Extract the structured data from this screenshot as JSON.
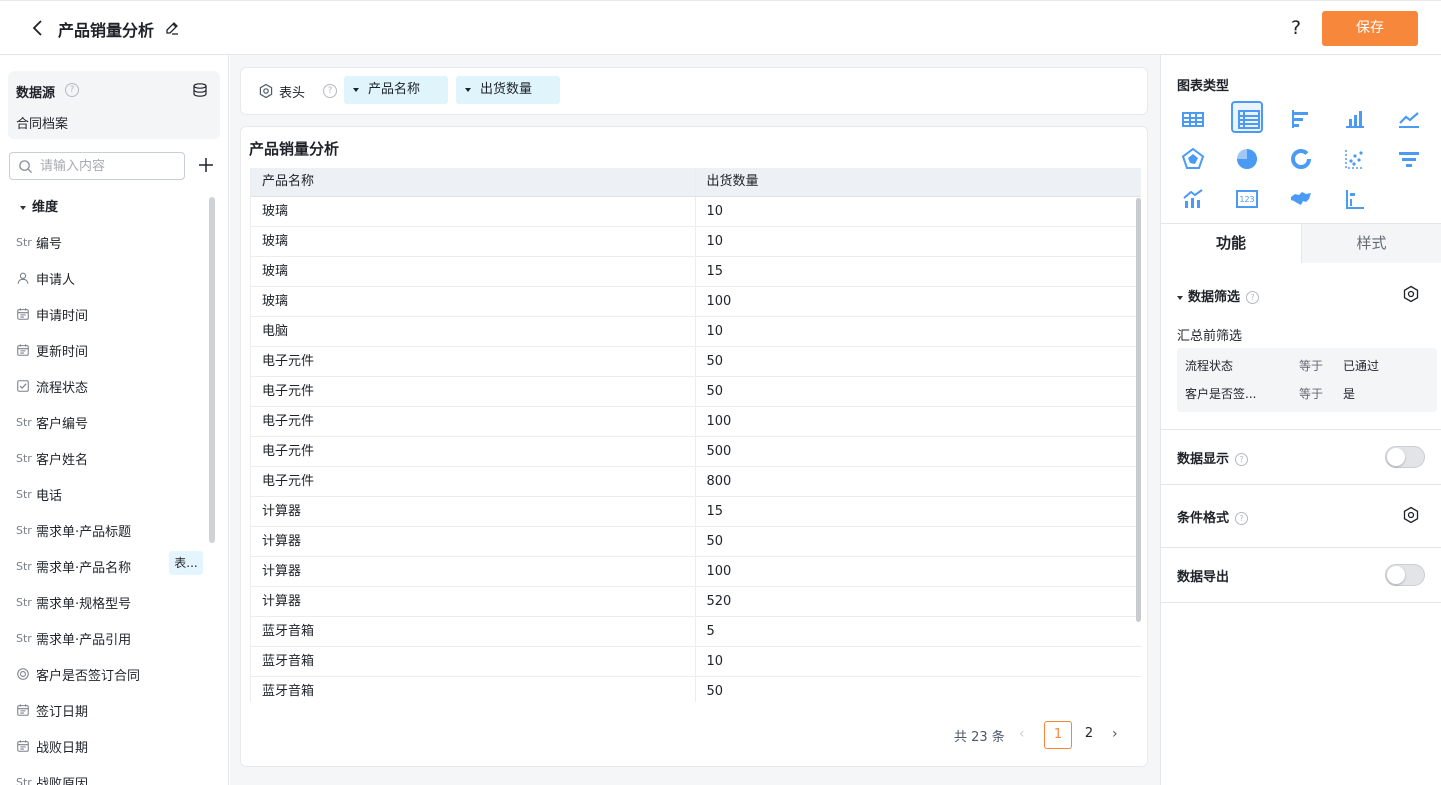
{
  "header": {
    "title": "产品销量分析",
    "help": "?",
    "save_label": "保存",
    "accent": "#f7873b"
  },
  "left": {
    "datasource_title": "数据源",
    "datasource_name": "合同档案",
    "search_placeholder": "请输入内容",
    "dimension_title": "维度",
    "fields": [
      {
        "icon": "Str",
        "label": "编号"
      },
      {
        "icon": "user-icon",
        "label": "申请人"
      },
      {
        "icon": "calendar-icon",
        "label": "申请时间"
      },
      {
        "icon": "calendar-icon",
        "label": "更新时间"
      },
      {
        "icon": "checkbox-icon",
        "label": "流程状态"
      },
      {
        "icon": "Str",
        "label": "客户编号"
      },
      {
        "icon": "Str",
        "label": "客户姓名"
      },
      {
        "icon": "Str",
        "label": "电话"
      },
      {
        "icon": "Str",
        "label": "需求单·产品标题"
      },
      {
        "icon": "Str",
        "label": "需求单·产品名称",
        "tag": "表..."
      },
      {
        "icon": "Str",
        "label": "需求单·规格型号"
      },
      {
        "icon": "Str",
        "label": "需求单·产品引用"
      },
      {
        "icon": "radio-icon",
        "label": "客户是否签订合同"
      },
      {
        "icon": "calendar-icon",
        "label": "签订日期"
      },
      {
        "icon": "calendar-icon",
        "label": "战败日期"
      },
      {
        "icon": "Str",
        "label": "战败原因"
      }
    ]
  },
  "center": {
    "header_label": "表头",
    "pills": [
      "产品名称",
      "出货数量"
    ],
    "card_title": "产品销量分析",
    "columns": [
      "产品名称",
      "出货数量"
    ],
    "rows": [
      [
        "玻璃",
        "10"
      ],
      [
        "玻璃",
        "10"
      ],
      [
        "玻璃",
        "15"
      ],
      [
        "玻璃",
        "100"
      ],
      [
        "电脑",
        "10"
      ],
      [
        "电子元件",
        "50"
      ],
      [
        "电子元件",
        "50"
      ],
      [
        "电子元件",
        "100"
      ],
      [
        "电子元件",
        "500"
      ],
      [
        "电子元件",
        "800"
      ],
      [
        "计算器",
        "15"
      ],
      [
        "计算器",
        "50"
      ],
      [
        "计算器",
        "100"
      ],
      [
        "计算器",
        "520"
      ],
      [
        "蓝牙音箱",
        "5"
      ],
      [
        "蓝牙音箱",
        "10"
      ],
      [
        "蓝牙音箱",
        "50"
      ]
    ],
    "pagination": {
      "total": "共 23 条",
      "pages": [
        "1",
        "2"
      ],
      "current": "1"
    }
  },
  "right": {
    "chart_type_title": "图表类型",
    "chart_types": [
      "table-icon",
      "detail-table-icon",
      "bar-horizontal-icon",
      "bar-vertical-icon",
      "line-icon",
      "radar-icon",
      "pie-icon",
      "donut-icon",
      "scatter-icon",
      "funnel-icon",
      "combo-icon",
      "number-card-icon",
      "map-icon",
      "gantt-icon"
    ],
    "selected_chart_type": "detail-table-icon",
    "tab_function": "功能",
    "tab_style": "样式",
    "filter_title": "数据筛选",
    "pre_filter_label": "汇总前筛选",
    "filters": [
      {
        "field": "流程状态",
        "op": "等于",
        "value": "已通过"
      },
      {
        "field": "客户是否签...",
        "op": "等于",
        "value": "是"
      }
    ],
    "data_display_label": "数据显示",
    "data_display_on": false,
    "conditional_format_label": "条件格式",
    "data_export_label": "数据导出",
    "data_export_on": false
  }
}
